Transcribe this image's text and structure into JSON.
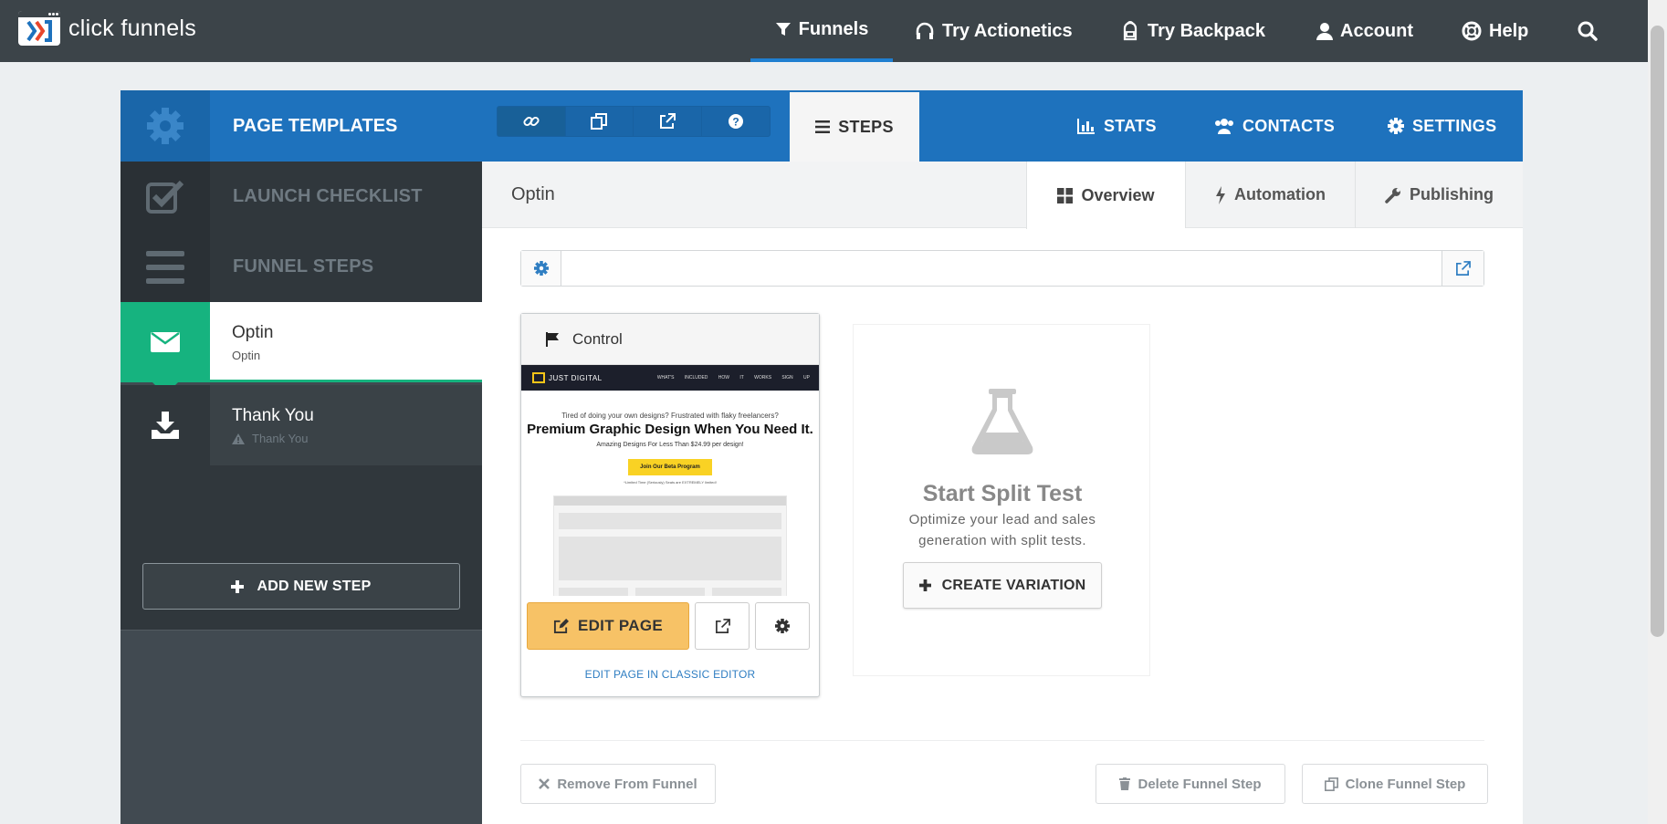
{
  "topnav": {
    "logo_text": "click funnels",
    "items": [
      {
        "label": "Funnels",
        "icon": "filter-icon",
        "active": true
      },
      {
        "label": "Try Actionetics",
        "icon": "headset-icon"
      },
      {
        "label": "Try Backpack",
        "icon": "backpack-icon"
      },
      {
        "label": "Account",
        "icon": "user-icon"
      },
      {
        "label": "Help",
        "icon": "lifebuoy-icon"
      }
    ],
    "search_icon": "search-icon",
    "accent_color": "#1f7fd0"
  },
  "header": {
    "title": "PAGE TEMPLATES",
    "tool_icons": [
      "link-icon",
      "copy-icon",
      "external-link-icon",
      "question-icon"
    ],
    "tabs": [
      {
        "label": "STEPS",
        "icon": "list-icon",
        "active": true
      },
      {
        "label": "STATS",
        "icon": "bar-chart-icon"
      },
      {
        "label": "CONTACTS",
        "icon": "users-icon"
      },
      {
        "label": "SETTINGS",
        "icon": "gear-icon"
      }
    ],
    "brand_color": "#1e72bd"
  },
  "sidebar": {
    "launch_checklist": "LAUNCH CHECKLIST",
    "funnel_steps": "FUNNEL STEPS",
    "steps": [
      {
        "title": "Optin",
        "subtitle": "Optin",
        "active": true,
        "color": "#16b37f"
      },
      {
        "title": "Thank You",
        "subtitle": "Thank You",
        "warning": true
      }
    ],
    "add_step": "ADD NEW STEP"
  },
  "content": {
    "title": "Optin",
    "tabs": [
      {
        "label": "Overview",
        "icon": "grid-icon",
        "active": true
      },
      {
        "label": "Automation",
        "icon": "bolt-icon"
      },
      {
        "label": "Publishing",
        "icon": "wrench-icon"
      }
    ],
    "url_value": "",
    "control": {
      "label": "Control",
      "preview": {
        "brand": "JUST DIGITAL",
        "links": "WHAT'S INCLUDED HOW IT WORKS SIGN UP",
        "line1": "Tired of doing your own designs? Frustrated with flaky freelancers?",
        "headline": "Premium Graphic Design When You Need It.",
        "line3": "Amazing Designs For Less Than $24.99 per design!",
        "cta": "Join Our Beta Program",
        "fine_print": "*Limited Time (Seriously) Seats are EXTREMELY limited!"
      },
      "edit_label": "EDIT PAGE",
      "classic_link": "EDIT PAGE IN CLASSIC EDITOR",
      "edit_color": "#f7c266"
    },
    "split": {
      "title": "Start Split Test",
      "description": "Optimize your lead and sales generation with split tests.",
      "button": "CREATE VARIATION"
    },
    "footer": {
      "remove": "Remove From Funnel",
      "delete": "Delete Funnel Step",
      "clone": "Clone Funnel Step"
    }
  }
}
